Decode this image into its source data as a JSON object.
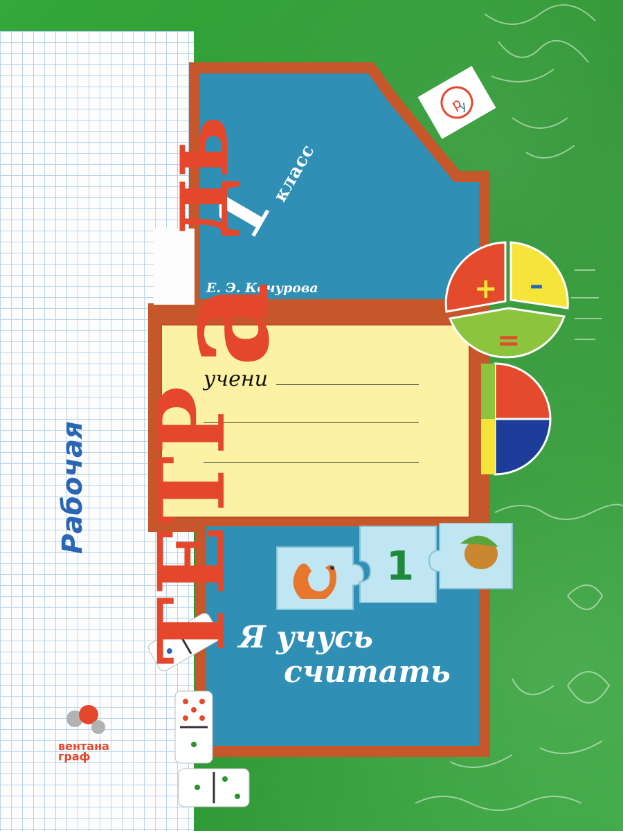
{
  "cover": {
    "series_label": "Рабочая",
    "title_part1": "ТЕТР",
    "title_letter": "а",
    "title_part2": "дь",
    "grade_number": "1",
    "grade_word": "класс",
    "author": "Е. Э. Кочурова",
    "label_prefix": "учени",
    "main_title_line1": "Я учусь",
    "main_title_line2": "считать",
    "puzzle_number": "1",
    "publisher_line1": "вентана",
    "publisher_line2": "граф",
    "wheel_plus": "+",
    "wheel_minus": "–",
    "wheel_equals": "="
  },
  "colors": {
    "background_green": "#2f9a35",
    "board_blue": "#2f8fb5",
    "frame_orange": "#c6572a",
    "title_red": "#e4472b",
    "label_yellow": "#fbf2a3",
    "accent_blue": "#2a66b4"
  },
  "icons": [
    "squirrel-icon",
    "acorn-icon",
    "domino-icon",
    "prosveshchenie-logo-icon",
    "ventana-graf-logo-icon",
    "arithmetic-wheel-icon"
  ]
}
